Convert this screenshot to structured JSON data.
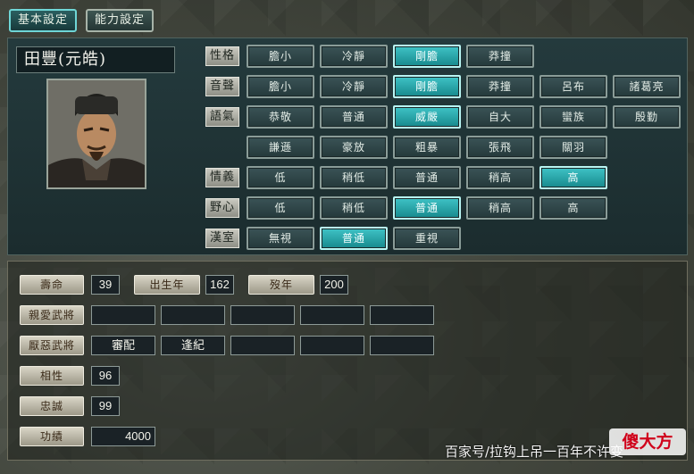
{
  "tabs": [
    {
      "label": "基本設定",
      "active": true
    },
    {
      "label": "能力設定",
      "active": false
    }
  ],
  "officer": {
    "name": "田豐(元皓)",
    "portrait_icon": "officer-portrait"
  },
  "traits": [
    {
      "label": "性格",
      "options": [
        {
          "text": "膽小",
          "sel": false
        },
        {
          "text": "冷靜",
          "sel": false
        },
        {
          "text": "剛膽",
          "sel": true
        },
        {
          "text": "莽撞",
          "sel": false
        }
      ]
    },
    {
      "label": "音聲",
      "options": [
        {
          "text": "膽小",
          "sel": false
        },
        {
          "text": "冷靜",
          "sel": false
        },
        {
          "text": "剛膽",
          "sel": true
        },
        {
          "text": "莽撞",
          "sel": false
        },
        {
          "text": "呂布",
          "sel": false
        },
        {
          "text": "諸葛亮",
          "sel": false
        }
      ]
    },
    {
      "label": "語氣",
      "options": [
        {
          "text": "恭敬",
          "sel": false
        },
        {
          "text": "普通",
          "sel": false
        },
        {
          "text": "威嚴",
          "sel": true
        },
        {
          "text": "自大",
          "sel": false
        },
        {
          "text": "蠻族",
          "sel": false
        },
        {
          "text": "殷勤",
          "sel": false
        }
      ]
    },
    {
      "label": "",
      "options": [
        {
          "text": "謙遜",
          "sel": false
        },
        {
          "text": "豪放",
          "sel": false
        },
        {
          "text": "粗暴",
          "sel": false
        },
        {
          "text": "張飛",
          "sel": false
        },
        {
          "text": "關羽",
          "sel": false
        }
      ]
    },
    {
      "label": "情義",
      "options": [
        {
          "text": "低",
          "sel": false
        },
        {
          "text": "稍低",
          "sel": false
        },
        {
          "text": "普通",
          "sel": false
        },
        {
          "text": "稍高",
          "sel": false
        },
        {
          "text": "高",
          "sel": true
        }
      ]
    },
    {
      "label": "野心",
      "options": [
        {
          "text": "低",
          "sel": false
        },
        {
          "text": "稍低",
          "sel": false
        },
        {
          "text": "普通",
          "sel": true
        },
        {
          "text": "稍高",
          "sel": false
        },
        {
          "text": "高",
          "sel": false
        }
      ]
    },
    {
      "label": "漢室",
      "options": [
        {
          "text": "無視",
          "sel": false
        },
        {
          "text": "普通",
          "sel": true
        },
        {
          "text": "重視",
          "sel": false
        }
      ]
    }
  ],
  "stats": {
    "lifespan_label": "壽命",
    "lifespan": "39",
    "birth_label": "出生年",
    "birth": "162",
    "death_label": "歿年",
    "death": "200",
    "liked_label": "親愛武將",
    "liked": [
      "",
      "",
      "",
      "",
      ""
    ],
    "disliked_label": "厭惡武將",
    "disliked": [
      "審配",
      "逢紀",
      "",
      "",
      ""
    ],
    "compat_label": "相性",
    "compat": "96",
    "loyalty_label": "忠誠",
    "loyalty": "99",
    "merit_label": "功績",
    "merit": "4000"
  },
  "watermark": {
    "text": "百家号/拉钩上吊一百年不许变",
    "logo": "傻大方"
  },
  "colors": {
    "selected": "#2bb0b3",
    "normal": "#2f4648",
    "label": "#b9b9af"
  }
}
